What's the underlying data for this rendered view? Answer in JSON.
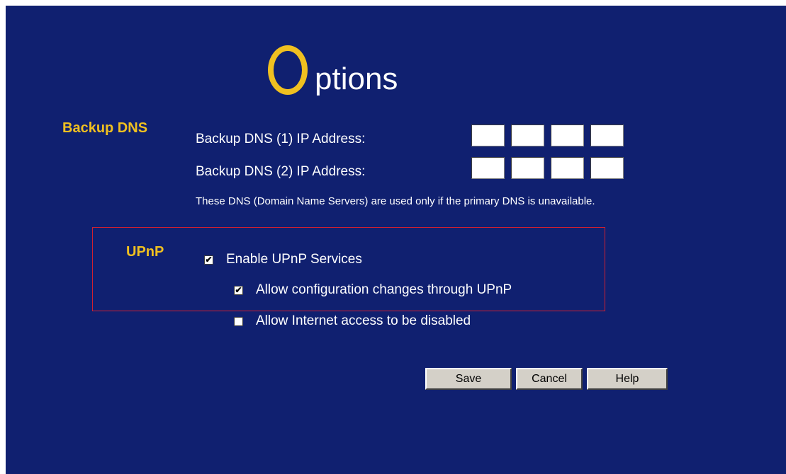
{
  "title": {
    "first_letter": "O",
    "rest": "ptions"
  },
  "backup_dns": {
    "section_label": "Backup DNS",
    "dns1_label": "Backup DNS (1) IP Address:",
    "dns2_label": "Backup DNS (2) IP Address:",
    "dns1_octets": [
      "",
      "",
      "",
      ""
    ],
    "dns2_octets": [
      "",
      "",
      "",
      ""
    ],
    "note": "These DNS (Domain Name Servers) are used only if the primary DNS is unavailable."
  },
  "upnp": {
    "section_label": "UPnP",
    "enable": {
      "label": "Enable UPnP Services",
      "checked": true
    },
    "allow_config": {
      "label": "Allow configuration changes through UPnP",
      "checked": true
    },
    "allow_disable": {
      "label": "Allow Internet access to be disabled",
      "checked": false
    }
  },
  "buttons": {
    "save": "Save",
    "cancel": "Cancel",
    "help": "Help"
  },
  "colors": {
    "background": "#102070",
    "accent": "#f0c020",
    "highlight_border": "#d02030",
    "button_face": "#d4d0c8"
  }
}
